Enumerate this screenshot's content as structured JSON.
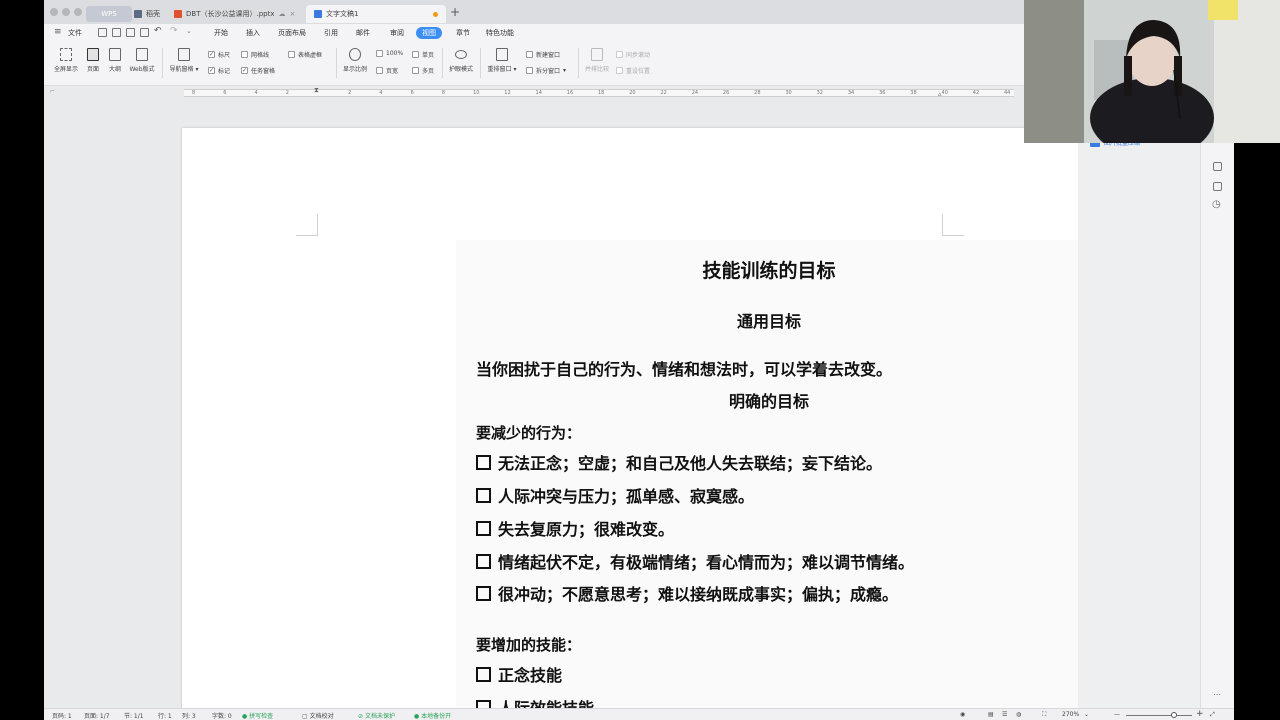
{
  "titlebar": {
    "tabs": [
      {
        "label": "WPS",
        "color": "#c4c9d3"
      },
      {
        "label": "稻壳",
        "color": "#5b6b85"
      },
      {
        "label": "DBT（长沙公益课用）.pptx",
        "color": "#e0522f"
      },
      {
        "label": "文字文稿1",
        "color": "#3a7be0"
      }
    ],
    "new_tab": "+"
  },
  "menubar": {
    "file": "文件",
    "items": [
      "开始",
      "插入",
      "页面布局",
      "引用",
      "邮件",
      "审阅",
      "视图",
      "章节",
      "特色功能"
    ],
    "active_index": 6
  },
  "ribbon": {
    "fullscreen": "全屏显示",
    "page_view": "页面",
    "outline": "大纲",
    "web": "Web版式",
    "nav_pane": "导航窗格",
    "ruler": "标尺",
    "gridlines": "网格线",
    "table_gridlines": "表格虚框",
    "marks": "标记",
    "taskpane": "任务窗格",
    "zoom_display": "显示比例",
    "zoom_100": "100%",
    "page_width": "页宽",
    "single_page": "单页",
    "multi_page": "多页",
    "eye_mode": "护眼模式",
    "arrange": "重排窗口",
    "new_window": "新建窗口",
    "split_window": "拆分窗口",
    "side_by_side": "并排比较",
    "sync_scroll": "同步滚动",
    "reset_pos": "重设位置"
  },
  "ruler_ticks": [
    "8",
    "6",
    "4",
    "2",
    "",
    "2",
    "4",
    "6",
    "8",
    "10",
    "12",
    "14",
    "16",
    "18",
    "20",
    "22",
    "24",
    "26",
    "28",
    "30",
    "32",
    "34",
    "36",
    "38",
    "40",
    "42",
    "44"
  ],
  "document": {
    "title": "技能训练的目标",
    "subtitle": "通用目标",
    "intro": "当你困扰于自己的行为、情绪和想法时，可以学着去改变。",
    "section": "明确的目标",
    "reduce_heading": "要减少的行为：",
    "reduce_items": [
      "无法正念；空虚；和自己及他人失去联结；妄下结论。",
      "人际冲突与压力；孤单感、寂寞感。",
      "失去复原力；很难改变。",
      "情绪起伏不定，有极端情绪；看心情而为；难以调节情绪。",
      "很冲动；不愿意思考；难以接纳既成事实；偏执；成瘾。"
    ],
    "increase_heading": "要增加的技能：",
    "increase_items": [
      "正念技能",
      "人际效能技能"
    ]
  },
  "right_panel": {
    "item": "图片批量压缩"
  },
  "status": {
    "page_num": "页码: 1",
    "pages": "页面: 1/7",
    "section": "节: 1/1",
    "line": "行: 1",
    "col": "列: 3",
    "words": "字数: 0",
    "spell": "拼写检查",
    "proof": "文档校对",
    "unprotected": "文档未保护",
    "backup": "本地备份开",
    "zoom": "270%",
    "zoom_minus": "—",
    "zoom_plus": "+",
    "zoom_level": 0.72
  }
}
